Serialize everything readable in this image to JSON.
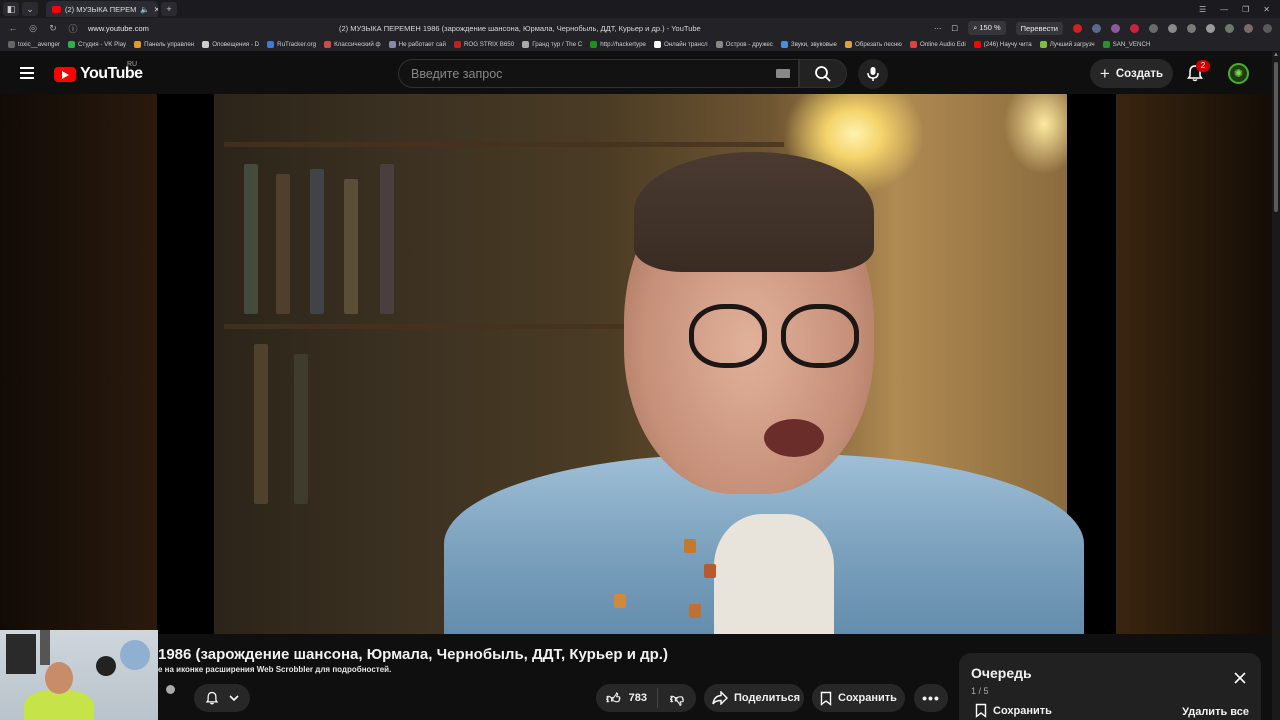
{
  "browser": {
    "tab_title": "(2) МУЗЫКА ПЕРЕМ",
    "url": "www.youtube.com",
    "window_title": "(2) МУЗЫКА ПЕРЕМЕН 1986 (зарождение шансона, Юрмала, Чернобыль, ДДТ, Курьер и др.) - YouTube",
    "zoom": "150 %",
    "translate_label": "Перевести",
    "bookmarks": [
      {
        "label": "toxic__avenger",
        "color": "#666666"
      },
      {
        "label": "Студия - VK Play",
        "color": "#2bb24c"
      },
      {
        "label": "Панель управлен",
        "color": "#e09b2d"
      },
      {
        "label": "Оповещения - D",
        "color": "#cccccc"
      },
      {
        "label": "RuTracker.org",
        "color": "#3c7bd6"
      },
      {
        "label": "Классический ф",
        "color": "#d04a4a"
      },
      {
        "label": "Не работает сай",
        "color": "#8888aa"
      },
      {
        "label": "ROG STRIX B650",
        "color": "#c02020"
      },
      {
        "label": "Гранд тур / The C",
        "color": "#aaaaaa"
      },
      {
        "label": "http://hackertype",
        "color": "#1f8f1f"
      },
      {
        "label": "Онлайн трансл",
        "color": "#ffffff"
      },
      {
        "label": "Остров - дружес",
        "color": "#888888"
      },
      {
        "label": "Звуки, звуковые",
        "color": "#4a90d9"
      },
      {
        "label": "Обрезать песню",
        "color": "#d9a04a"
      },
      {
        "label": "Online Audio Edi",
        "color": "#e04040"
      },
      {
        "label": "(246) Научу чита",
        "color": "#ff0000"
      },
      {
        "label": "Лучший загрузч",
        "color": "#7bbf3a"
      },
      {
        "label": "SAN_VENCH",
        "color": "#2b8f2b"
      }
    ]
  },
  "header": {
    "logo_text": "YouTube",
    "logo_region": "RU",
    "search_placeholder": "Введите запрос",
    "create_label": "Создать",
    "notification_count": "2"
  },
  "video": {
    "title": "1986 (зарождение шансона, Юрмала, Чернобыль, ДДТ, Курьер и др.)",
    "scrobbler_note": "е на иконке расширения Web Scrobbler для подробностей.",
    "like_count": "783",
    "share_label": "Поделиться",
    "save_label": "Сохранить"
  },
  "queue": {
    "title": "Очередь",
    "position": "1 / 5",
    "save_label": "Сохранить",
    "remove_all_label": "Удалить все"
  },
  "colors": {
    "accent": "#ff0000",
    "background": "#0f0f0f",
    "button_bg": "#272727"
  }
}
